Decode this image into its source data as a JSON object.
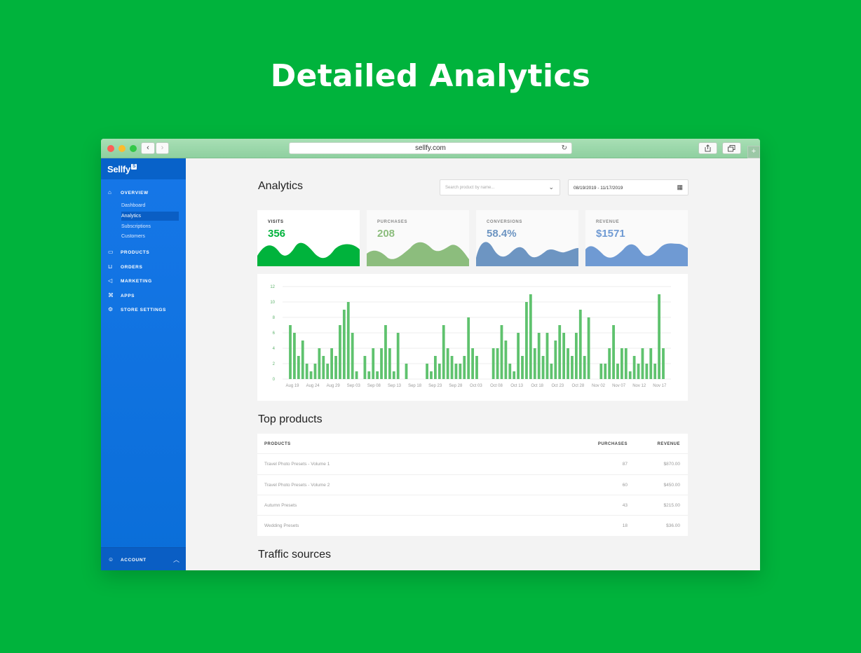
{
  "headline": "Detailed Analytics",
  "browser": {
    "url": "sellfy.com",
    "back_glyph": "‹",
    "forward_glyph": "›",
    "reload_glyph": "↻",
    "plus_glyph": "+"
  },
  "sidebar": {
    "brand": "Sellfy",
    "brand_badge": "S",
    "items": [
      {
        "label": "OVERVIEW",
        "icon": "home-icon",
        "glyph": "⌂"
      },
      {
        "label": "PRODUCTS",
        "icon": "folder-icon",
        "glyph": "▭"
      },
      {
        "label": "ORDERS",
        "icon": "basket-icon",
        "glyph": "⊔"
      },
      {
        "label": "MARKETING",
        "icon": "megaphone-icon",
        "glyph": "◁"
      },
      {
        "label": "APPS",
        "icon": "apps-icon",
        "glyph": "⌘"
      },
      {
        "label": "STORE SETTINGS",
        "icon": "gear-icon",
        "glyph": "⚙"
      }
    ],
    "sub_items": [
      "Dashboard",
      "Analytics",
      "Subscriptions",
      "Customers"
    ],
    "active_sub_item": "Analytics",
    "account": {
      "label": "ACCOUNT",
      "glyph": "☺",
      "chevron": "︿"
    }
  },
  "main": {
    "title": "Analytics",
    "search_placeholder": "Search product by name...",
    "date_range": "08/19/2019 - 11/17/2019",
    "stats": [
      {
        "label": "VISITS",
        "value": "356",
        "color": "#00b33c"
      },
      {
        "label": "PURCHASES",
        "value": "208",
        "color": "#8cbd7d"
      },
      {
        "label": "CONVERSIONS",
        "value": "58.4%",
        "color": "#6d95c2"
      },
      {
        "label": "REVENUE",
        "value": "$1571",
        "color": "#6f9ad3"
      }
    ],
    "top_products_title": "Top products",
    "traffic_sources_title": "Traffic sources",
    "table": {
      "headers": [
        "PRODUCTS",
        "PURCHASES",
        "REVENUE"
      ],
      "rows": [
        {
          "product": "Travel Photo Presets - Volume 1",
          "purchases": "87",
          "revenue": "$870.00"
        },
        {
          "product": "Travel Photo Presets - Volume 2",
          "purchases": "60",
          "revenue": "$450.00"
        },
        {
          "product": "Autumn Presets",
          "purchases": "43",
          "revenue": "$215.00"
        },
        {
          "product": "Wedding Presets",
          "purchases": "18",
          "revenue": "$36.00"
        }
      ]
    }
  },
  "chart_data": {
    "type": "bar",
    "color": "#5fc26e",
    "ylim": [
      0,
      12
    ],
    "yticks": [
      0,
      2,
      4,
      6,
      8,
      10,
      12
    ],
    "grid": true,
    "xtick_labels": [
      "Aug 19",
      "Aug 24",
      "Aug 29",
      "Sep 03",
      "Sep 08",
      "Sep 13",
      "Sep 18",
      "Sep 23",
      "Sep 28",
      "Oct 03",
      "Oct 08",
      "Oct 13",
      "Oct 18",
      "Oct 23",
      "Oct 28",
      "Nov 02",
      "Nov 07",
      "Nov 12",
      "Nov 17"
    ],
    "values": [
      7,
      6,
      3,
      5,
      2,
      1,
      2,
      4,
      3,
      2,
      4,
      3,
      7,
      9,
      10,
      6,
      1,
      0,
      3,
      1,
      4,
      1,
      4,
      7,
      4,
      1,
      6,
      0,
      2,
      0,
      0,
      0,
      0,
      2,
      1,
      3,
      2,
      7,
      4,
      3,
      2,
      2,
      3,
      8,
      4,
      3,
      0,
      0,
      0,
      4,
      4,
      7,
      5,
      2,
      1,
      6,
      3,
      10,
      11,
      4,
      6,
      3,
      6,
      2,
      5,
      7,
      6,
      4,
      3,
      6,
      9,
      3,
      8,
      0,
      0,
      2,
      2,
      4,
      7,
      2,
      4,
      4,
      1,
      3,
      2,
      4,
      2,
      4,
      2,
      11,
      4
    ]
  }
}
